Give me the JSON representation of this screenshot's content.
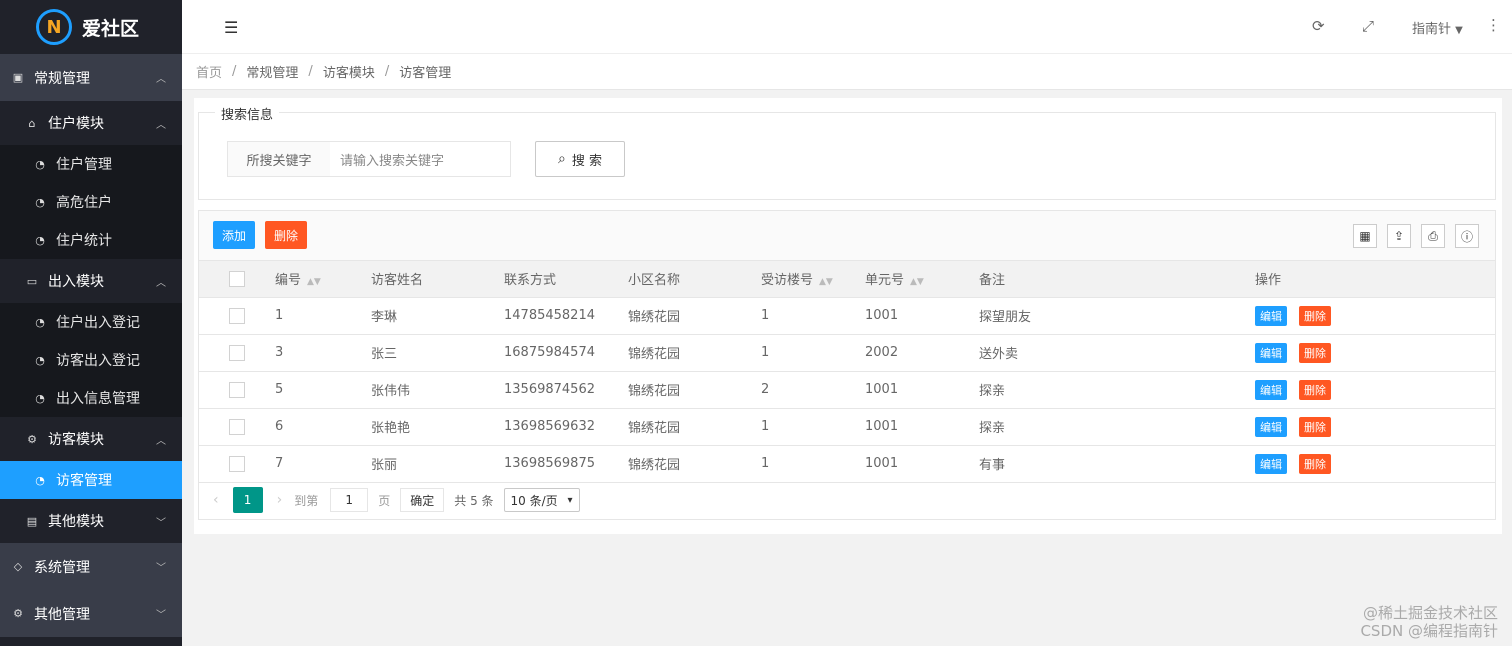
{
  "app": {
    "logo_letter": "N",
    "name": "爱社区"
  },
  "sidebar": {
    "groups": [
      {
        "label": "常规管理",
        "icon": "contacts-icon",
        "arrow": "^"
      },
      {
        "label": "系统管理",
        "icon": "leaf-icon",
        "arrow": "v"
      },
      {
        "label": "其他管理",
        "icon": "gear-icon",
        "arrow": "v"
      }
    ],
    "subs": [
      {
        "label": "住户模块",
        "icon": "home-icon",
        "arrow": "^"
      },
      {
        "label": "出入模块",
        "icon": "window-icon",
        "arrow": "^"
      },
      {
        "label": "访客模块",
        "icon": "gears-icon",
        "arrow": "^"
      },
      {
        "label": "其他模块",
        "icon": "file-icon",
        "arrow": "v"
      }
    ],
    "leaves": [
      {
        "label": "住户管理",
        "icon": "dashboard-icon"
      },
      {
        "label": "高危住户",
        "icon": "dashboard-icon"
      },
      {
        "label": "住户统计",
        "icon": "dashboard-icon"
      },
      {
        "label": "住户出入登记",
        "icon": "dashboard-icon"
      },
      {
        "label": "访客出入登记",
        "icon": "dashboard-icon"
      },
      {
        "label": "出入信息管理",
        "icon": "dashboard-icon"
      },
      {
        "label": "访客管理",
        "icon": "dashboard-icon"
      }
    ]
  },
  "header": {
    "user": "指南针"
  },
  "breadcrumb": [
    "首页",
    "常规管理",
    "访客模块",
    "访客管理"
  ],
  "search": {
    "legend": "搜索信息",
    "label": "所搜关键字",
    "placeholder": "请输入搜索关键字",
    "button": "搜 索"
  },
  "toolbar": {
    "add": "添加",
    "delete": "删除"
  },
  "table": {
    "headers": [
      "编号",
      "访客姓名",
      "联系方式",
      "小区名称",
      "受访楼号",
      "单元号",
      "备注",
      "操作"
    ],
    "rows": [
      {
        "id": "1",
        "name": "李琳",
        "phone": "14785458214",
        "estate": "锦绣花园",
        "building": "1",
        "unit": "1001",
        "note": "探望朋友"
      },
      {
        "id": "3",
        "name": "张三",
        "phone": "16875984574",
        "estate": "锦绣花园",
        "building": "1",
        "unit": "2002",
        "note": "送外卖"
      },
      {
        "id": "5",
        "name": "张伟伟",
        "phone": "13569874562",
        "estate": "锦绣花园",
        "building": "2",
        "unit": "1001",
        "note": "探亲"
      },
      {
        "id": "6",
        "name": "张艳艳",
        "phone": "13698569632",
        "estate": "锦绣花园",
        "building": "1",
        "unit": "1001",
        "note": "探亲"
      },
      {
        "id": "7",
        "name": "张丽",
        "phone": "13698569875",
        "estate": "锦绣花园",
        "building": "1",
        "unit": "1001",
        "note": "有事"
      }
    ],
    "edit": "编辑",
    "delete": "删除"
  },
  "pager": {
    "current": "1",
    "goto": "到第",
    "input": "1",
    "page": "页",
    "ok": "确定",
    "total": "共 5 条",
    "size": "10 条/页"
  },
  "watermark": {
    "line1": "@稀土掘金技术社区",
    "line2": "CSDN @编程指南针"
  }
}
